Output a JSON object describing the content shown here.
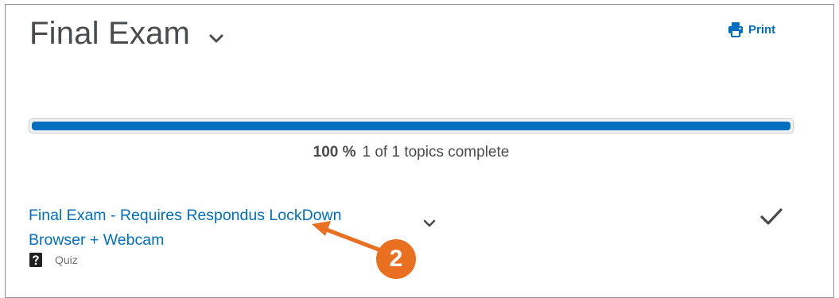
{
  "header": {
    "title": "Final Exam",
    "print_label": "Print"
  },
  "progress": {
    "percent_label": "100 %",
    "percent_value": 100,
    "summary": "1 of 1 topics complete"
  },
  "topic": {
    "title": "Final Exam - Requires Respondus LockDown Browser + Webcam",
    "type": "Quiz",
    "completed": true
  },
  "callout": {
    "number": "2"
  },
  "icons": {
    "title_dropdown": "chevron-down-icon",
    "print": "printer-icon",
    "topic_dropdown": "chevron-down-icon",
    "complete": "checkmark-icon",
    "topic_type": "quiz-icon"
  },
  "colors": {
    "link": "#006fbf",
    "progress_fill": "#006fbf",
    "text": "#494c4e",
    "callout": "#e96f21"
  }
}
